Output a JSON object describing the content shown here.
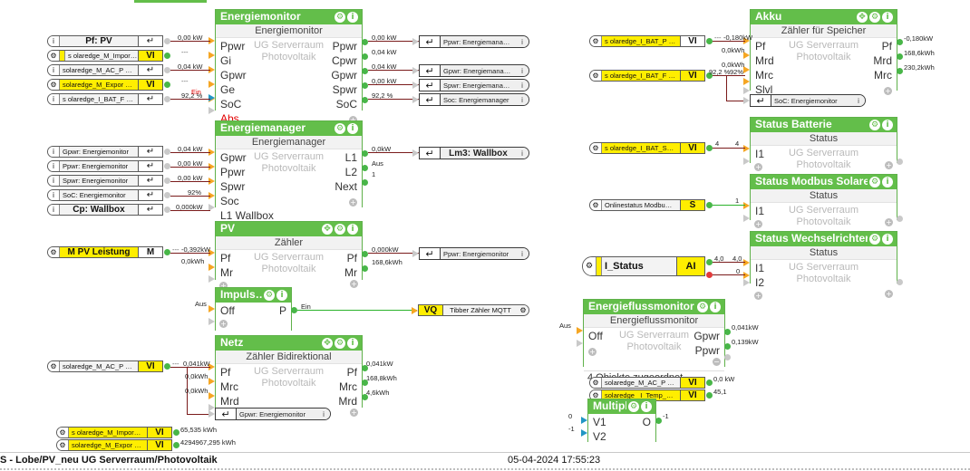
{
  "app": {
    "status_left": "S - Lobe/PV_neu    UG Serverraum/Photovoltaik",
    "status_time": "05-04-2024 17:55:23"
  },
  "icons": {
    "gear": "⚙",
    "info": "i",
    "move": "✥",
    "plus": "+",
    "minus": "−",
    "goto": "↵",
    "info_small": "i"
  },
  "blocks": {
    "energiemonitor": {
      "title": "Energiemonitor",
      "subcaption": "Energiemonitor",
      "center1": "UG Serverraum",
      "center2": "Photovoltaik",
      "inputs": [
        "Ppwr",
        "Gi",
        "Gpwr",
        "Ge",
        "SoC",
        "Abs"
      ],
      "outputs": [
        "Ppwr",
        "Cpwr",
        "Gpwr",
        "Spwr",
        "SoC"
      ]
    },
    "energiemanager": {
      "title": "Energiemanager",
      "subcaption": "Energiemanager",
      "center1": "UG Serverraum",
      "center2": "Photovoltaik",
      "inputs": [
        "Gpwr",
        "Ppwr",
        "Spwr",
        "Soc",
        "L1 Wallbox"
      ],
      "outputs": [
        "L1",
        "L2",
        "Next"
      ]
    },
    "pv": {
      "title": "PV",
      "subcaption": "Zähler",
      "center1": "UG Serverraum",
      "center2": "Photovoltaik",
      "inputs": [
        "Pf",
        "Mr"
      ],
      "outputs": [
        "Pf",
        "Mr"
      ]
    },
    "impuls": {
      "title": "Impuls…",
      "inputs": [
        "Off"
      ],
      "outputs": [
        "P"
      ]
    },
    "netz": {
      "title": "Netz",
      "subcaption": "Zähler Bidirektional",
      "center1": "UG Serverraum",
      "center2": "Photovoltaik",
      "inputs": [
        "Pf",
        "Mrc",
        "Mrd"
      ],
      "outputs": [
        "Pf",
        "Mrc",
        "Mrd"
      ]
    },
    "akku": {
      "title": "Akku",
      "subcaption": "Zähler für Speicher",
      "center1": "UG Serverraum",
      "center2": "Photovoltaik",
      "inputs": [
        "Pf",
        "Mrd",
        "Mrc",
        "Slvl"
      ],
      "outputs": [
        "Pf",
        "Mrd",
        "Mrc"
      ]
    },
    "status_batterie": {
      "title": "Status Batterie",
      "subcaption": "Status",
      "center1": "UG Serverraum",
      "center2": "Photovoltaik",
      "inputs": [
        "I1"
      ]
    },
    "status_modbus": {
      "title": "Status Modbus Solaredge",
      "subcaption": "Status",
      "center1": "UG Serverraum",
      "center2": "Photovoltaik",
      "inputs": [
        "I1"
      ]
    },
    "status_wechselrichter": {
      "title": "Status Wechselrichter",
      "subcaption": "Status",
      "center1": "UG Serverraum",
      "center2": "Photovoltaik",
      "inputs": [
        "I1",
        "I2"
      ]
    },
    "energieflussmonitor": {
      "title": "Energieflussmonitor",
      "subcaption": "Energieflussmonitor",
      "center1": "UG Serverraum",
      "center2": "Photovoltaik",
      "inputs": [
        "Off"
      ],
      "outputs": [
        "Gpwr",
        "Ppwr"
      ],
      "footnote": "4 Objekte zugeordnet"
    },
    "multiplikator": {
      "title": "Multipli…",
      "inputs": [
        "V1",
        "V2"
      ],
      "outputs": [
        "O"
      ]
    }
  },
  "capsules": {
    "em_in1": {
      "name": "Pf: PV",
      "tag": "goto"
    },
    "em_in2": {
      "name": "s olaredge_M_Impor…",
      "tag": "VI"
    },
    "em_in3": {
      "name": "solaredge_M_AC_P …",
      "tag": "goto"
    },
    "em_in4": {
      "name": "solaredge_M_Expor …",
      "tag": "VI"
    },
    "em_in5": {
      "name": "s olaredge_I_BAT_F …",
      "tag": "goto"
    },
    "mg_in1": {
      "name": "Gpwr: Energiemonitor",
      "tag": "goto"
    },
    "mg_in2": {
      "name": "Ppwr: Energiemonitor",
      "tag": "goto"
    },
    "mg_in3": {
      "name": "Spwr: Energiemonitor",
      "tag": "goto"
    },
    "mg_in4": {
      "name": "SoC: Energiemonitor",
      "tag": "goto"
    },
    "mg_in5": {
      "name": "Cp: Wallbox",
      "tag": "goto"
    },
    "pv_in1": {
      "name": "M PV Leistung",
      "tag": "M"
    },
    "netz_in1": {
      "name": "solaredge_M_AC_P …",
      "tag": "VI"
    },
    "akku_in1": {
      "name": "s olaredge_I_BAT_P …",
      "tag": "VI"
    },
    "akku_in2": {
      "name": "s olaredge_I_BAT_F …",
      "tag": "VI"
    },
    "batt_in1": {
      "name": "s olaredge_I_BAT_S…",
      "tag": "VI"
    },
    "modbus_in1": {
      "name": "Onlinestatus  Modbu…",
      "tag": "S"
    },
    "wr_in1": {
      "name": "I_Status",
      "tag": "AI"
    },
    "mult_in1": {
      "name": "solaredge_M_AC_P …",
      "tag": "VI"
    },
    "mult_in2": {
      "name": "solaredge_  I_Temp_…",
      "tag": "VI"
    },
    "bot_1": {
      "name": "s olaredge_M_Impor…",
      "tag": "VI"
    },
    "bot_2": {
      "name": "solaredge_M_Expor …",
      "tag": "VI"
    },
    "vq_out": {
      "name": "Tibber Zähler MQTT",
      "tag": "VQ"
    }
  },
  "refboxes": {
    "em_out1": "Ppwr:  Energiemana…",
    "em_out2": "Gpwr:  Energiemana…",
    "em_out3": "Spwr:  Energiemana…",
    "em_out4": "Soc:  Energiemanager",
    "mg_out1": "Lm3: Wallbox",
    "pv_out1": "Ppwr: Energiemonitor",
    "netz_extra": "Gpwr: Energiemonitor",
    "akku_extra": "SoC: Energiemonitor"
  },
  "wirelabels": {
    "em_i1": "0,00 kW",
    "em_i2": "---",
    "em_i3": "0,04 kW",
    "em_i4": "---",
    "em_i5": "92,2 %",
    "em_i6": "Ein",
    "em_o1": "0,00 kW",
    "em_o2": "0,04 kW",
    "em_o3": "0,04 kW",
    "em_o4": "0,00 kW",
    "em_o5": "92,2 %",
    "mg_i1": "0,04 kW",
    "mg_i2": "0,00 kW",
    "mg_i3": "0,00 kW",
    "mg_i4": "92%",
    "mg_i5": "0,000kW",
    "mg_o1": "0,0kW",
    "mg_o2": "Aus",
    "mg_o3": "1",
    "pv_i1": "-0,392kW",
    "pv_i2": "0,0kWh",
    "pv_i1dash": "---",
    "pv_o1": "0,000kW",
    "pv_o2": "168,6kWh",
    "imp_i1": "Aus",
    "imp_o1": "Ein",
    "netz_i1": "0,041kW",
    "netz_i1dash": "---",
    "netz_i2": "0,0kWh",
    "netz_i3": "0,0kWh",
    "netz_o1": "0,041kW",
    "netz_o2": "168,8kWh",
    "netz_o3": "4,6kWh",
    "akku_i1": "-0,180kW",
    "akku_i1dash": "---",
    "akku_i2": "0,0kWh",
    "akku_i3": "0,0kWh",
    "akku_i4a": "92,2 %",
    "akku_i4b": "92%",
    "akku_o1": "-0,180kW",
    "akku_o2": "168,6kWh",
    "akku_o3": "230,2kWh",
    "batt_i1a": "4",
    "batt_i1b": "4",
    "modbus_i1": "1",
    "wr_i1a": "4,0",
    "wr_i1b": "4,0",
    "wr_i2": "0",
    "efm_i1": "Aus",
    "efm_o1": "0,041kW",
    "efm_o2": "0,139kW",
    "mult_i1": "0,0 kW",
    "mult_i2": "45,1",
    "mult_o1": "-1",
    "mult_p1": "0",
    "mult_p2": "-1",
    "bot_1": "65,535 kWh",
    "bot_2": "4294967,295 kWh"
  }
}
